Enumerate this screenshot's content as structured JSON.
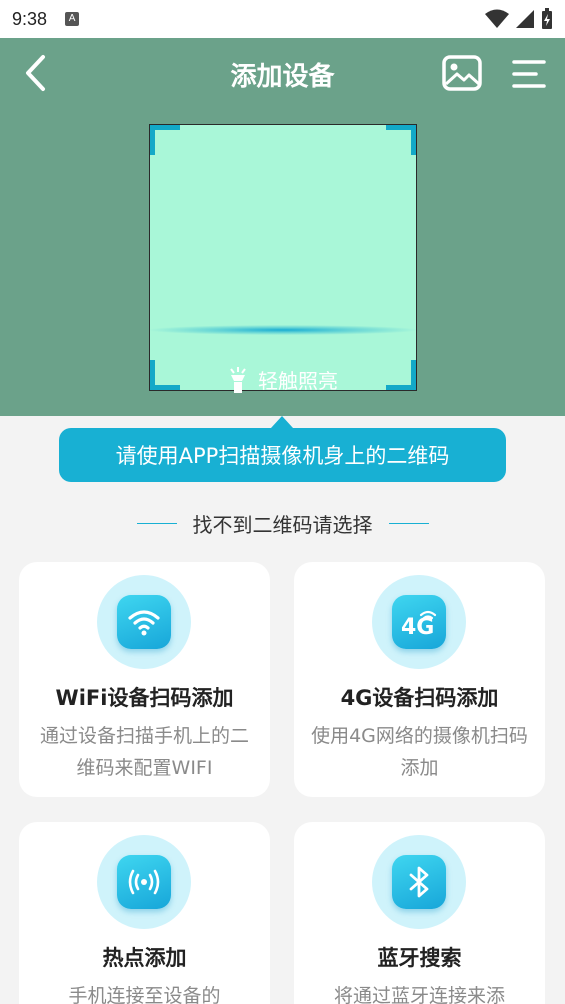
{
  "status_bar": {
    "time": "9:38",
    "notification_letter": "A"
  },
  "header": {
    "title": "添加设备"
  },
  "scanner": {
    "torch_label": "轻触照亮"
  },
  "tooltip": "请使用APP扫描摄像机身上的二维码",
  "separator": "找不到二维码请选择",
  "options": [
    {
      "title": "WiFi设备扫码添加",
      "desc": "通过设备扫描手机上的二维码来配置WIFI",
      "icon": "wifi-icon"
    },
    {
      "title": "4G设备扫码添加",
      "desc": "使用4G网络的摄像机扫码添加",
      "icon": "4g-icon",
      "icon_text": "4G"
    },
    {
      "title": "热点添加",
      "desc": "手机连接至设备的",
      "icon": "hotspot-icon"
    },
    {
      "title": "蓝牙搜索",
      "desc": "将通过蓝牙连接来添",
      "icon": "bluetooth-icon"
    }
  ],
  "colors": {
    "accent": "#18b0d3",
    "header_bg": "#6ba28a",
    "scan_bg": "#a9f7d8"
  }
}
